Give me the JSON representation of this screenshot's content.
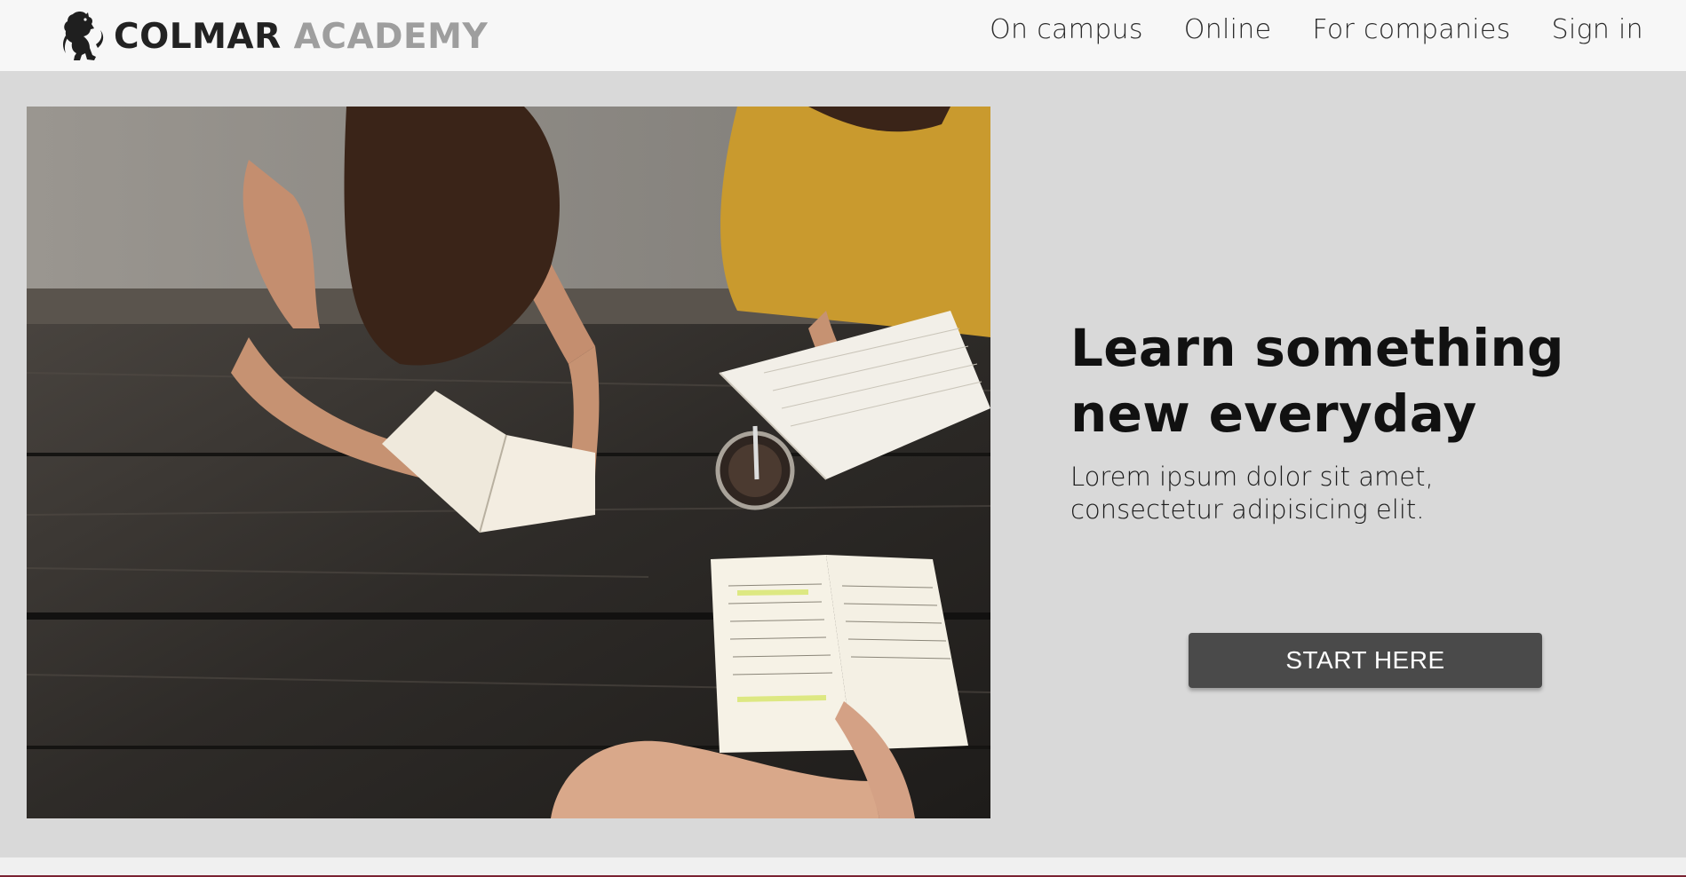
{
  "header": {
    "brand": {
      "word1": "COLMAR",
      "word2": "ACADEMY",
      "icon": "lion-icon"
    },
    "nav": [
      {
        "label": "On campus"
      },
      {
        "label": "Online"
      },
      {
        "label": "For companies"
      },
      {
        "label": "Sign in"
      }
    ]
  },
  "hero": {
    "title_line1": "Learn something",
    "title_line2": "new everyday",
    "subtitle_line1": "Lorem ipsum dolor sit amet,",
    "subtitle_line2": "consectetur adipisicing elit.",
    "cta_label": "START HERE",
    "image": "students-studying-at-table-photo"
  },
  "colors": {
    "header_bg": "#f7f7f7",
    "hero_bg": "#d9d9d9",
    "button_bg": "#4a4a4a",
    "brand_gray": "#9e9e9e",
    "accent_line": "#7a2232"
  }
}
